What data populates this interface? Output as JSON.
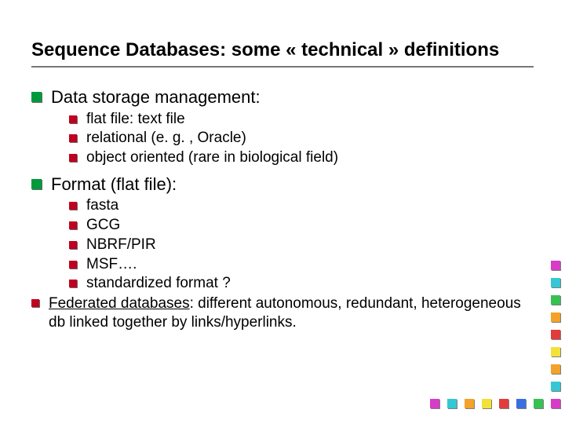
{
  "title": "Sequence Databases: some « technical » definitions",
  "sections": [
    {
      "heading": "Data storage management:",
      "items": [
        "flat file: text file",
        "relational (e. g. , Oracle)",
        "object oriented (rare in biological field)"
      ]
    },
    {
      "heading": "Format (flat file):",
      "items": [
        "fasta",
        "GCG",
        "NBRF/PIR",
        "MSF…. ",
        "standardized format ?"
      ]
    }
  ],
  "federated": {
    "lead": "Federated databases",
    "rest": ": different autonomous, redundant, heterogeneous db linked together by links/hyperlinks."
  },
  "deco_colors": {
    "magenta": "#d63cc8",
    "cyan": "#35c7d4",
    "green": "#37c152",
    "orange": "#f3a22a",
    "red": "#e23b3b",
    "yellow": "#f3e13a",
    "blue": "#3a6fe2"
  }
}
